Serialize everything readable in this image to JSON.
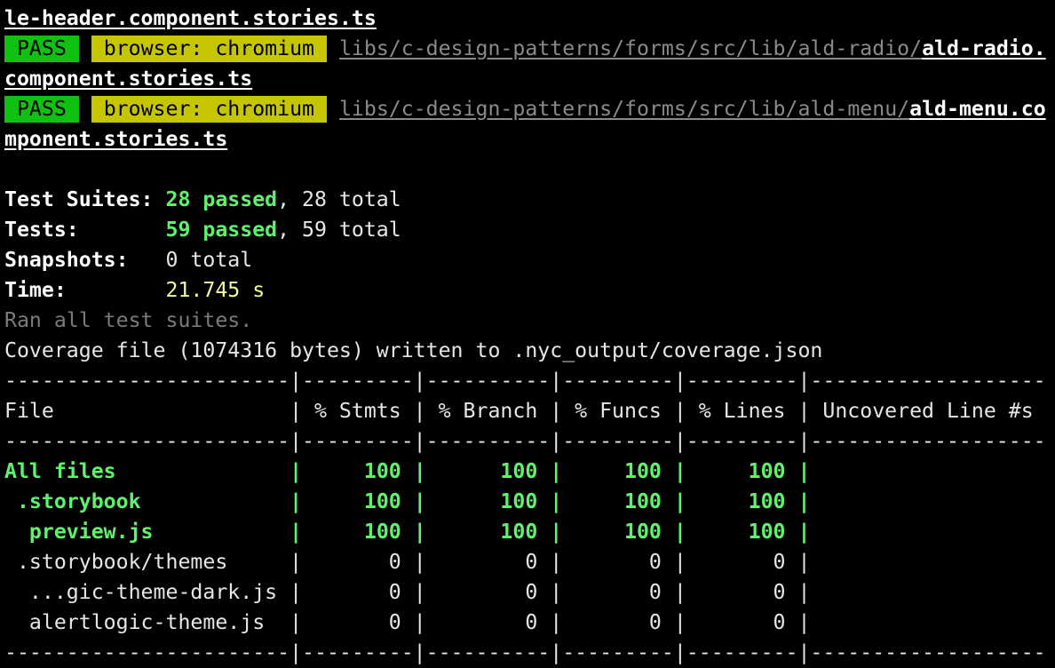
{
  "terminal": {
    "lines": {
      "l1": "le-header.component.stories.ts",
      "l2_pass": " PASS ",
      "l2_browser": " browser: chromium ",
      "l2_path": "libs/c-design-patterns/forms/src/lib/ald-radio/",
      "l2_file": "ald-radio.",
      "l3": "component.stories.ts",
      "l4_pass": " PASS ",
      "l4_browser": " browser: chromium ",
      "l4_path": "libs/c-design-patterns/forms/src/lib/ald-menu/",
      "l4_file": "ald-menu.co",
      "l5": "mponent.stories.ts",
      "suites_label": "Test Suites: ",
      "suites_passed": "28 passed",
      "suites_total": ", 28 total",
      "tests_label": "Tests:       ",
      "tests_passed": "59 passed",
      "tests_total": ", 59 total",
      "snapshots_label": "Snapshots:   ",
      "snapshots_value": "0 total",
      "time_label": "Time:        ",
      "time_value": "21.745 s",
      "ran_all": "Ran all test suites.",
      "coverage_written": "Coverage file (1074316 bytes) written to .nyc_output/coverage.json"
    },
    "table": {
      "separator": "-----------------------|---------|----------|---------|---------|-------------------",
      "header": "File                   | % Stmts | % Branch | % Funcs | % Lines | Uncovered Line #s ",
      "rows": [
        {
          "file": "All files              ",
          "cells": "|     100 |      100 |     100 |     100 |",
          "color": "green",
          "bold": true
        },
        {
          "file": " .storybook            ",
          "cells": "|     100 |      100 |     100 |     100 |",
          "color": "green",
          "bold": true
        },
        {
          "file": "  preview.js           ",
          "cells": "|     100 |      100 |     100 |     100 |",
          "color": "green",
          "bold": true
        },
        {
          "file": " .storybook/themes     ",
          "cells": "|       0 |        0 |       0 |       0 |",
          "color": "plain",
          "bold": false
        },
        {
          "file": "  ...gic-theme-dark.js ",
          "cells": "|       0 |        0 |       0 |       0 |",
          "color": "plain",
          "bold": false
        },
        {
          "file": "  alertlogic-theme.js  ",
          "cells": "|       0 |        0 |       0 |       0 |",
          "color": "plain",
          "bold": false
        }
      ]
    }
  },
  "colors": {
    "background": "#000000",
    "pass_badge": "#11c111",
    "browser_badge": "#c6c600",
    "passed_green": "#5ff26c",
    "time_yellow": "#f3f99d"
  }
}
